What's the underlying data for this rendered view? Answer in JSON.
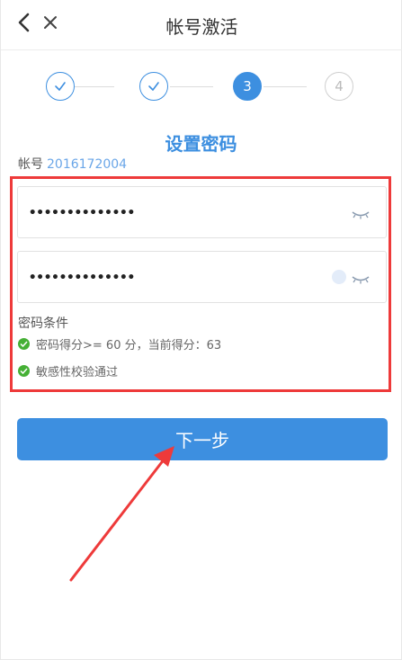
{
  "header": {
    "title": "帐号激活",
    "back_icon": "chevron-left-icon",
    "close_icon": "close-icon"
  },
  "steps": [
    {
      "state": "done",
      "label": ""
    },
    {
      "state": "done",
      "label": ""
    },
    {
      "state": "active",
      "label": "3"
    },
    {
      "state": "todo",
      "label": "4"
    }
  ],
  "section_title": "设置密码",
  "account": {
    "label": "帐号",
    "value": "2016172004"
  },
  "password_field": {
    "value": "••••••••••••••"
  },
  "confirm_field": {
    "value": "••••••••••••••"
  },
  "conditions": {
    "title": "密码条件",
    "items": [
      "密码得分>= 60 分，当前得分：63",
      "敏感性校验通过"
    ]
  },
  "next_button": {
    "label": "下一步"
  },
  "colors": {
    "accent": "#3d8fe0",
    "highlight": "#ee3a3a",
    "success": "#45b035"
  }
}
